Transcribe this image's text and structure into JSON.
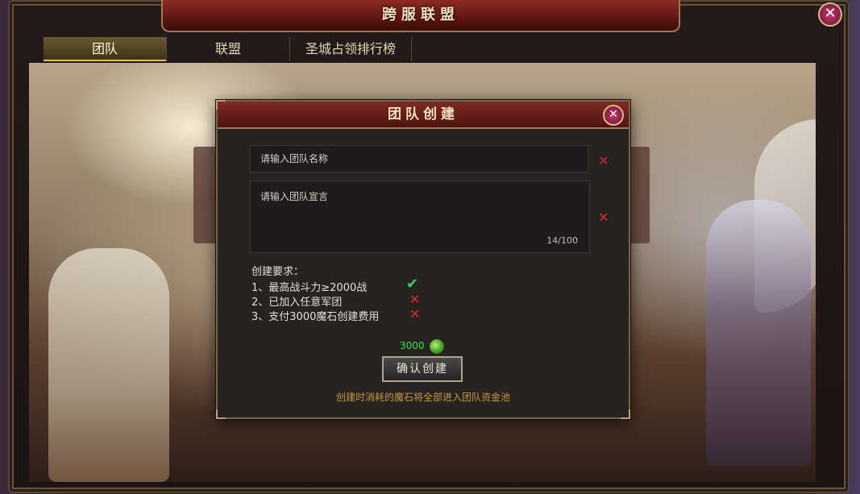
{
  "window": {
    "title": "跨服联盟",
    "close_label": "✕"
  },
  "tabs": [
    {
      "label": "团队",
      "active": true
    },
    {
      "label": "联盟",
      "active": false
    },
    {
      "label": "圣城占领排行榜",
      "active": false
    }
  ],
  "dialog": {
    "title": "团队创建",
    "close_label": "✕",
    "name_input": {
      "placeholder": "请输入团队名称",
      "value": ""
    },
    "declaration_input": {
      "placeholder": "请输入团队宣言",
      "value": "",
      "counter": "14/100"
    },
    "requirements_title": "创建要求：",
    "requirements": [
      {
        "text": "1、最高战斗力≥2000战",
        "met": true
      },
      {
        "text": "2、已加入任意军团",
        "met": false
      },
      {
        "text": "3、支付3000魔石创建费用",
        "met": false
      }
    ],
    "cost": "3000",
    "cost_icon": "magic-stone-icon",
    "confirm_label": "确认创建",
    "note": "创建时消耗的魔石将全部进入团队资金池"
  },
  "colors": {
    "title_red": "#7e2a24",
    "gold_border": "#9a7a50",
    "invalid_red": "#e0262a",
    "valid_green": "#3ad24a",
    "cost_green": "#3ee04a",
    "note_orange": "#c8963a"
  }
}
